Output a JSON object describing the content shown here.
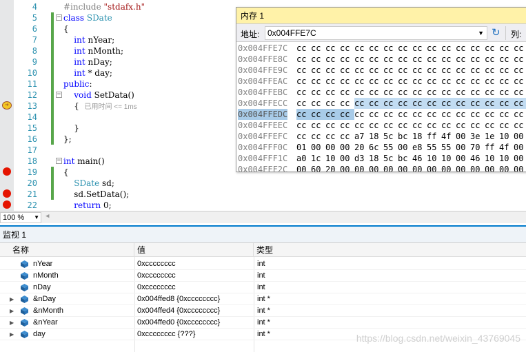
{
  "editor": {
    "lines": [
      {
        "num": "4",
        "parts": [
          {
            "t": "#include ",
            "c": "pp"
          },
          {
            "t": "\"stdafx.h\"",
            "c": "str"
          }
        ]
      },
      {
        "num": "5",
        "parts": [
          {
            "t": "class ",
            "c": "kw"
          },
          {
            "t": "SDate",
            "c": "ty"
          }
        ]
      },
      {
        "num": "6",
        "parts": [
          {
            "t": "{",
            "c": ""
          }
        ]
      },
      {
        "num": "7",
        "parts": [
          {
            "t": "    int",
            "c": "kw"
          },
          {
            "t": " nYear;",
            "c": ""
          }
        ]
      },
      {
        "num": "8",
        "parts": [
          {
            "t": "    int",
            "c": "kw"
          },
          {
            "t": " nMonth;",
            "c": ""
          }
        ]
      },
      {
        "num": "9",
        "parts": [
          {
            "t": "    int",
            "c": "kw"
          },
          {
            "t": " nDay;",
            "c": ""
          }
        ]
      },
      {
        "num": "10",
        "parts": [
          {
            "t": "    int",
            "c": "kw"
          },
          {
            "t": " * day;",
            "c": ""
          }
        ]
      },
      {
        "num": "11",
        "parts": [
          {
            "t": "public",
            "c": "kw"
          },
          {
            "t": ":",
            "c": ""
          }
        ]
      },
      {
        "num": "12",
        "parts": [
          {
            "t": "    void",
            "c": "kw"
          },
          {
            "t": " SetData()",
            "c": ""
          }
        ]
      },
      {
        "num": "13",
        "parts": [
          {
            "t": "    {  ",
            "c": ""
          }
        ]
      },
      {
        "num": "14",
        "parts": [
          {
            "t": "",
            "c": ""
          }
        ]
      },
      {
        "num": "15",
        "parts": [
          {
            "t": "    }",
            "c": ""
          }
        ]
      },
      {
        "num": "16",
        "parts": [
          {
            "t": "};",
            "c": ""
          }
        ]
      },
      {
        "num": "17",
        "parts": [
          {
            "t": "",
            "c": ""
          }
        ]
      },
      {
        "num": "18",
        "parts": [
          {
            "t": "int",
            "c": "kw"
          },
          {
            "t": " main()",
            "c": ""
          }
        ]
      },
      {
        "num": "19",
        "parts": [
          {
            "t": "{",
            "c": ""
          }
        ]
      },
      {
        "num": "20",
        "parts": [
          {
            "t": "    ",
            "c": ""
          },
          {
            "t": "SDate",
            "c": "ty"
          },
          {
            "t": " sd;",
            "c": ""
          }
        ]
      },
      {
        "num": "21",
        "parts": [
          {
            "t": "    sd.SetData();",
            "c": ""
          }
        ]
      },
      {
        "num": "22",
        "parts": [
          {
            "t": "    ",
            "c": ""
          },
          {
            "t": "return",
            "c": "kw"
          },
          {
            "t": " 0;",
            "c": ""
          }
        ]
      }
    ],
    "perf_tip": "已用时间 <= 1ms",
    "zoom": "100 %"
  },
  "memory": {
    "title": "内存 1",
    "address_label": "地址:",
    "address_value": "0x004FFE7C",
    "columns_label": "列:",
    "rows": [
      {
        "addr": "0x004FFE7C",
        "bytes": [
          "cc",
          "cc",
          "cc",
          "cc",
          "cc",
          "cc",
          "cc",
          "cc",
          "cc",
          "cc",
          "cc",
          "cc",
          "cc",
          "cc",
          "cc",
          "cc"
        ]
      },
      {
        "addr": "0x004FFE8C",
        "bytes": [
          "cc",
          "cc",
          "cc",
          "cc",
          "cc",
          "cc",
          "cc",
          "cc",
          "cc",
          "cc",
          "cc",
          "cc",
          "cc",
          "cc",
          "cc",
          "cc"
        ]
      },
      {
        "addr": "0x004FFE9C",
        "bytes": [
          "cc",
          "cc",
          "cc",
          "cc",
          "cc",
          "cc",
          "cc",
          "cc",
          "cc",
          "cc",
          "cc",
          "cc",
          "cc",
          "cc",
          "cc",
          "cc"
        ]
      },
      {
        "addr": "0x004FFEAC",
        "bytes": [
          "cc",
          "cc",
          "cc",
          "cc",
          "cc",
          "cc",
          "cc",
          "cc",
          "cc",
          "cc",
          "cc",
          "cc",
          "cc",
          "cc",
          "cc",
          "cc"
        ]
      },
      {
        "addr": "0x004FFEBC",
        "bytes": [
          "cc",
          "cc",
          "cc",
          "cc",
          "cc",
          "cc",
          "cc",
          "cc",
          "cc",
          "cc",
          "cc",
          "cc",
          "cc",
          "cc",
          "cc",
          "cc"
        ]
      },
      {
        "addr": "0x004FFECC",
        "bytes": [
          "cc",
          "cc",
          "cc",
          "cc",
          "cc",
          "cc",
          "cc",
          "cc",
          "cc",
          "cc",
          "cc",
          "cc",
          "cc",
          "cc",
          "cc",
          "cc"
        ]
      },
      {
        "addr": "0x004FFEDC",
        "bytes": [
          "cc",
          "cc",
          "cc",
          "cc",
          "cc",
          "cc",
          "cc",
          "cc",
          "cc",
          "cc",
          "cc",
          "cc",
          "cc",
          "cc",
          "cc",
          "cc"
        ]
      },
      {
        "addr": "0x004FFEEC",
        "bytes": [
          "cc",
          "cc",
          "cc",
          "cc",
          "cc",
          "cc",
          "cc",
          "cc",
          "cc",
          "cc",
          "cc",
          "cc",
          "cc",
          "cc",
          "cc",
          "cc"
        ]
      },
      {
        "addr": "0x004FFEFC",
        "bytes": [
          "cc",
          "cc",
          "cc",
          "cc",
          "a7",
          "18",
          "5c",
          "bc",
          "18",
          "ff",
          "4f",
          "00",
          "3e",
          "1e",
          "10",
          "00"
        ]
      },
      {
        "addr": "0x004FFF0C",
        "bytes": [
          "01",
          "00",
          "00",
          "00",
          "20",
          "6c",
          "55",
          "00",
          "e8",
          "55",
          "55",
          "00",
          "70",
          "ff",
          "4f",
          "00"
        ]
      },
      {
        "addr": "0x004FFF1C",
        "bytes": [
          "a0",
          "1c",
          "10",
          "00",
          "d3",
          "18",
          "5c",
          "bc",
          "46",
          "10",
          "10",
          "00",
          "46",
          "10",
          "10",
          "00"
        ]
      },
      {
        "addr": "0x004FFF2C",
        "bytes": [
          "00",
          "60",
          "20",
          "00",
          "00",
          "00",
          "00",
          "00",
          "00",
          "00",
          "00",
          "00",
          "00",
          "00",
          "00",
          "00"
        ]
      }
    ]
  },
  "watch": {
    "title": "监视 1",
    "headers": {
      "name": "名称",
      "value": "值",
      "type": "类型"
    },
    "rows": [
      {
        "name": "nYear",
        "value": "0xcccccccc",
        "type": "int",
        "expandable": false
      },
      {
        "name": "nMonth",
        "value": "0xcccccccc",
        "type": "int",
        "expandable": false
      },
      {
        "name": "nDay",
        "value": "0xcccccccc",
        "type": "int",
        "expandable": false
      },
      {
        "name": "&nDay",
        "value": "0x004ffed8 {0xcccccccc}",
        "type": "int *",
        "expandable": true
      },
      {
        "name": "&nMonth",
        "value": "0x004ffed4 {0xcccccccc}",
        "type": "int *",
        "expandable": true
      },
      {
        "name": "&nYear",
        "value": "0x004ffed0 {0xcccccccc}",
        "type": "int *",
        "expandable": true
      },
      {
        "name": "day",
        "value": "0xcccccccc {???}",
        "type": "int *",
        "expandable": true
      }
    ]
  },
  "watermark": "https://blog.csdn.net/weixin_43769045"
}
